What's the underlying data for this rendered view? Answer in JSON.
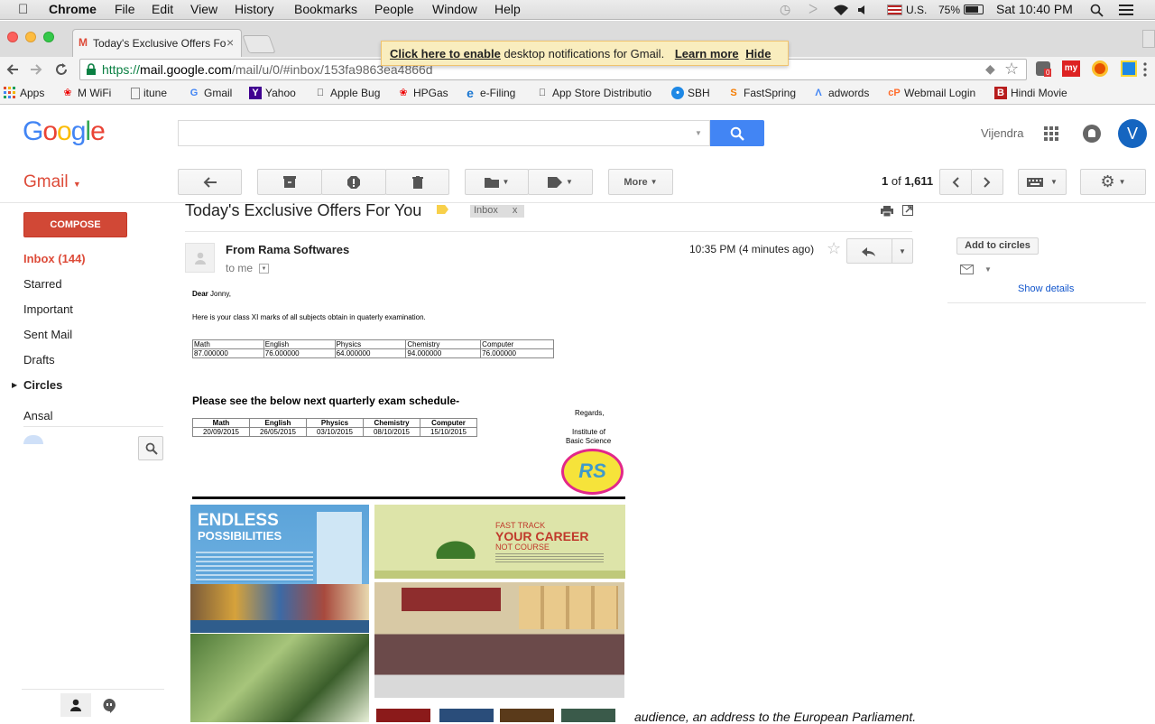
{
  "mac": {
    "menus": [
      "Chrome",
      "File",
      "Edit",
      "View",
      "History",
      "Bookmarks",
      "People",
      "Window",
      "Help"
    ],
    "input_source": "U.S.",
    "battery": "75%",
    "clock": "Sat 10:40 PM"
  },
  "browser": {
    "tab_title": "Today's Exclusive Offers Fo",
    "url_secure": "https://",
    "url_host": "mail.google.com",
    "url_path": "/mail/u/0/#inbox/153fa9863ea4866d",
    "ext_badge": "0",
    "ext_my": "my"
  },
  "bookmarks": [
    {
      "label": "Apps",
      "icon": "apps-grid-icon"
    },
    {
      "label": "M WiFi",
      "icon": "huawei-icon"
    },
    {
      "label": "itune",
      "icon": "page-icon"
    },
    {
      "label": "Gmail",
      "icon": "google-g-icon"
    },
    {
      "label": "Yahoo",
      "icon": "yahoo-icon"
    },
    {
      "label": "Apple Bug",
      "icon": "apple-icon"
    },
    {
      "label": "HPGas",
      "icon": "huawei-icon"
    },
    {
      "label": "e-Filing",
      "icon": "ie-icon"
    },
    {
      "label": "App Store Distributio",
      "icon": "apple-icon"
    },
    {
      "label": "SBH",
      "icon": "sbh-icon"
    },
    {
      "label": "FastSpring",
      "icon": "fastspring-icon"
    },
    {
      "label": "adwords",
      "icon": "adwords-icon"
    },
    {
      "label": "Webmail Login",
      "icon": "cpanel-icon"
    },
    {
      "label": "Hindi Movie",
      "icon": "b-icon"
    }
  ],
  "google": {
    "logo": "Google",
    "user_name": "Vijendra",
    "avatar_letter": "V"
  },
  "notification": {
    "link": "Click here to enable",
    "text": " desktop notifications for Gmail.",
    "learn": "Learn more",
    "hide": "Hide"
  },
  "gmail": {
    "brand": "Gmail",
    "more_label": "More",
    "pager_prefix": "1",
    "pager_of": " of ",
    "pager_total": "1,611",
    "compose": "COMPOSE",
    "nav": [
      "Inbox (144)",
      "Starred",
      "Important",
      "Sent Mail",
      "Drafts",
      "Circles",
      "Ansal"
    ]
  },
  "message": {
    "subject": "Today's Exclusive Offers For You",
    "label": "Inbox",
    "label_close": "x",
    "from": "From Rama Softwares",
    "to": "to me",
    "time": "10:35 PM (4 minutes ago)",
    "greeting_bold": "Dear",
    "greeting_name": " Jonny,",
    "intro": "Here is your class XI marks of all subjects obtain in quaterly examination.",
    "marks_headers": [
      "Math",
      "English",
      "Physics",
      "Chemistry",
      "Computer"
    ],
    "marks_values": [
      "87.000000",
      "76.000000",
      "64.000000",
      "94.000000",
      "76.000000"
    ],
    "schedule_heading": "Please see the below next quarterly exam schedule-",
    "schedule_headers": [
      "Math",
      "English",
      "Physics",
      "Chemistry",
      "Computer"
    ],
    "schedule_dates": [
      "20/09/2015",
      "26/05/2015",
      "03/10/2015",
      "08/10/2015",
      "15/10/2015"
    ],
    "regards": "Regards,",
    "org_line1": "Institute of",
    "org_line2": "Basic Science",
    "logo_letters": "RS",
    "ad1_title1": "ENDLESS",
    "ad1_title2": "POSSIBILITIES",
    "ad2_title1": "FAST TRACK",
    "ad2_title2": "YOUR CAREER",
    "ad2_title3": "NOT COURSE",
    "bottom_text": "audience, an address to the European Parliament."
  },
  "sidebar": {
    "add_circles": "Add to circles",
    "show_details": "Show details"
  },
  "colors": {
    "gmail_red": "#dd4b39",
    "link_blue": "#1155cc",
    "google_blue": "#4285f4"
  }
}
